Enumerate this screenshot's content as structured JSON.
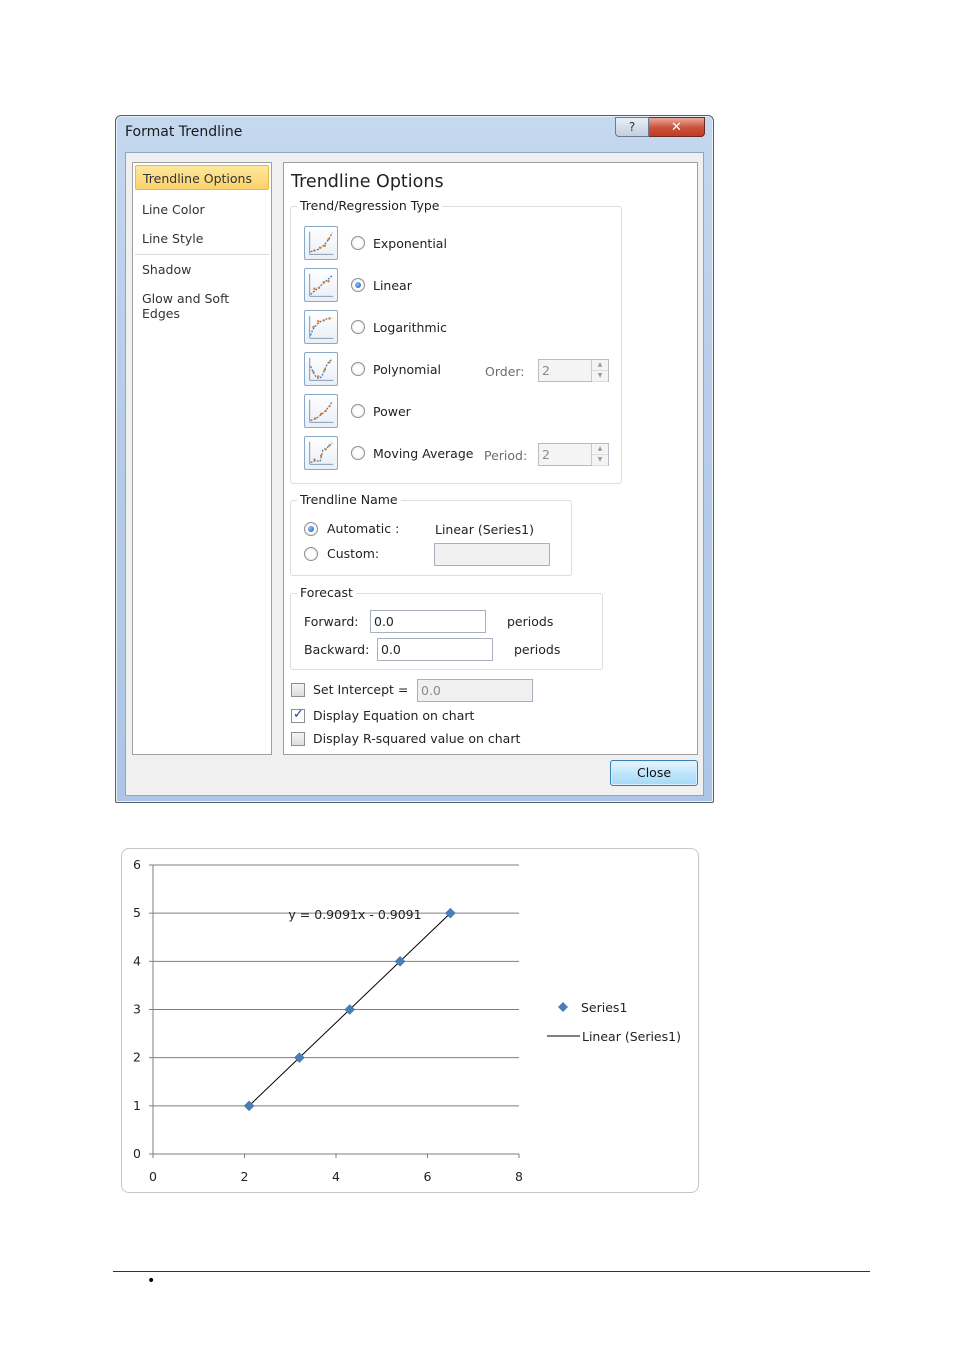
{
  "dialog": {
    "title": "Format Trendline",
    "help_glyph": "?",
    "close_glyph": "✕",
    "nav": [
      {
        "label": "Trendline Options",
        "selected": true
      },
      {
        "label": "Line Color"
      },
      {
        "label": "Line Style"
      },
      {
        "label": "Shadow"
      },
      {
        "label": "Glow and Soft Edges"
      }
    ],
    "heading": "Trendline Options",
    "regression": {
      "group_label": "Trend/Regression Type",
      "types": [
        {
          "label": "Exponential",
          "icon": "exponential-trend-icon",
          "checked": false
        },
        {
          "label": "Linear",
          "icon": "linear-trend-icon",
          "checked": true
        },
        {
          "label": "Logarithmic",
          "icon": "logarithmic-trend-icon",
          "checked": false
        },
        {
          "label": "Polynomial",
          "icon": "polynomial-trend-icon",
          "checked": false
        },
        {
          "label": "Power",
          "icon": "power-trend-icon",
          "checked": false
        },
        {
          "label": "Moving Average",
          "icon": "moving-average-trend-icon",
          "checked": false
        }
      ],
      "order_label": "Order:",
      "order_value": "2",
      "period_label": "Period:",
      "period_value": "2"
    },
    "name": {
      "group_label": "Trendline Name",
      "automatic_label": "Automatic :",
      "automatic_value": "Linear (Series1)",
      "custom_label": "Custom:",
      "custom_value": ""
    },
    "forecast": {
      "group_label": "Forecast",
      "forward_label": "Forward:",
      "forward_value": "0.0",
      "backward_label": "Backward:",
      "backward_value": "0.0",
      "unit": "periods"
    },
    "options": {
      "set_intercept_label": "Set Intercept =",
      "set_intercept_value": "0.0",
      "set_intercept_checked": false,
      "display_equation_label": "Display Equation on chart",
      "display_equation_checked": true,
      "display_r2_label": "Display R-squared value on chart",
      "display_r2_checked": false
    },
    "close_label": "Close"
  },
  "chart_data": {
    "type": "scatter",
    "title": "",
    "xlabel": "",
    "ylabel": "",
    "xlim": [
      0,
      8
    ],
    "ylim": [
      0,
      6
    ],
    "x_ticks": [
      "0",
      "2",
      "4",
      "6",
      "8"
    ],
    "y_ticks": [
      "0",
      "1",
      "2",
      "3",
      "4",
      "5",
      "6"
    ],
    "grid": "horizontal",
    "legend": "right",
    "series": [
      {
        "name": "Series1",
        "marker": "diamond",
        "color": "#4a7ebb",
        "x": [
          2.1,
          3.2,
          4.3,
          5.4,
          6.5
        ],
        "y": [
          1,
          2,
          3,
          4,
          5
        ]
      }
    ],
    "trendline": {
      "name": "Linear (Series1)",
      "slope": 0.9091,
      "intercept": -0.9091,
      "color": "#000000"
    },
    "equation_label": "y = 0.9091x - 0.9091"
  },
  "footer": {
    "bullet": "•"
  }
}
